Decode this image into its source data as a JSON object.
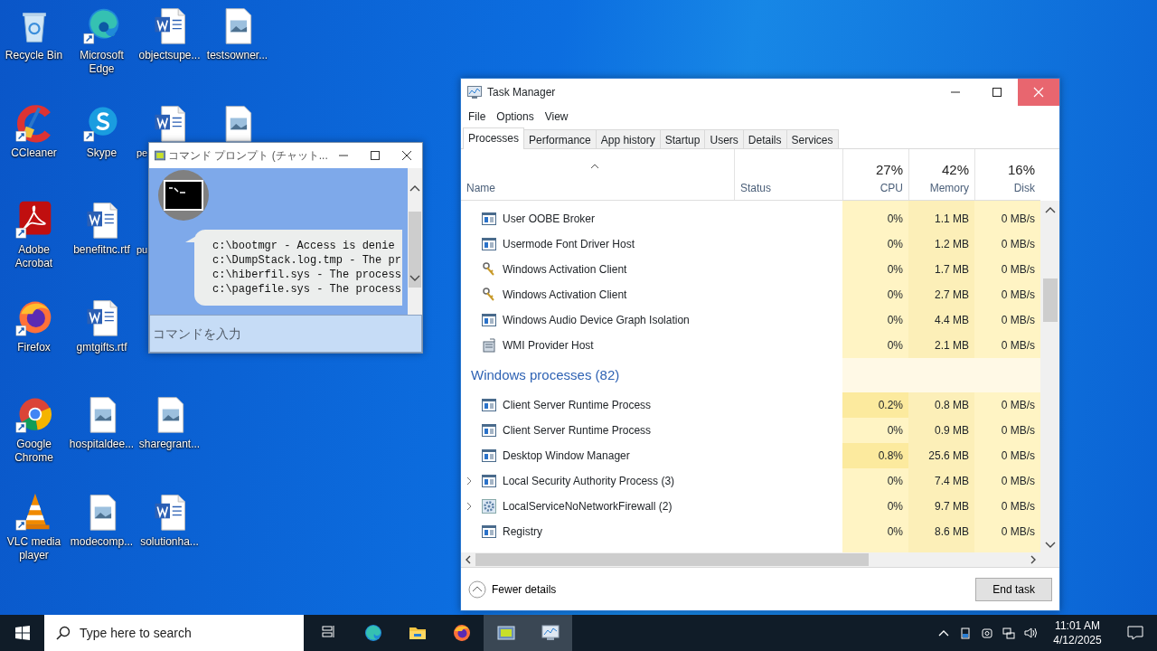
{
  "desktop_columns": [
    [
      {
        "label": "Recycle Bin",
        "kind": "recycle",
        "shortcut": false
      },
      {
        "label": "CCleaner",
        "kind": "ccleaner",
        "shortcut": true
      },
      {
        "label": "Adobe Acrobat",
        "kind": "acrobat",
        "shortcut": true
      },
      {
        "label": "Firefox",
        "kind": "firefox",
        "shortcut": true
      },
      {
        "label": "Google Chrome",
        "kind": "chrome",
        "shortcut": true
      },
      {
        "label": "VLC media player",
        "kind": "vlc",
        "shortcut": true
      }
    ],
    [
      {
        "label": "Microsoft Edge",
        "kind": "edge",
        "shortcut": true
      },
      {
        "label": "Skype",
        "kind": "skype",
        "shortcut": true
      },
      {
        "label": "benefitnc.rtf",
        "kind": "word",
        "shortcut": false
      },
      {
        "label": "gmtgifts.rtf",
        "kind": "word",
        "shortcut": false
      },
      {
        "label": "hospitaldee...",
        "kind": "image",
        "shortcut": false
      },
      {
        "label": "modecomp...",
        "kind": "image",
        "shortcut": false
      }
    ],
    [
      {
        "label": "objectsupe...",
        "kind": "word",
        "shortcut": false
      },
      {
        "label": "pe",
        "kind": "word-covered",
        "shortcut": false
      },
      {
        "label": "pu",
        "kind": "covered"
      },
      {
        "kind": "hidden"
      },
      {
        "label": "sharegrant...",
        "kind": "image",
        "shortcut": false
      },
      {
        "label": "solutionha...",
        "kind": "word",
        "shortcut": false
      }
    ],
    [
      {
        "label": "testsowner...",
        "kind": "image",
        "shortcut": false
      },
      {
        "kind": "image-covered",
        "shortcut": false
      }
    ]
  ],
  "chat_window": {
    "title": "コマンド プロンプト (チャット...",
    "lines": [
      "c:\\bootmgr - Access is denie",
      "c:\\DumpStack.log.tmp - The pr",
      "c:\\hiberfil.sys - The process",
      "c:\\pagefile.sys - The process"
    ],
    "input": {
      "placeholder": "コマンドを入力"
    }
  },
  "task_manager": {
    "title": "Task Manager",
    "menu": [
      "File",
      "Options",
      "View"
    ],
    "tabs": [
      {
        "label": "Processes",
        "selected": true
      },
      {
        "label": "Performance",
        "selected": false
      },
      {
        "label": "App history",
        "selected": false
      },
      {
        "label": "Startup",
        "selected": false
      },
      {
        "label": "Users",
        "selected": false
      },
      {
        "label": "Details",
        "selected": false
      },
      {
        "label": "Services",
        "selected": false
      }
    ],
    "columns": {
      "name": "Name",
      "status": "Status",
      "cpu": {
        "percent": "27%",
        "label": "CPU"
      },
      "memory": {
        "percent": "42%",
        "label": "Memory"
      },
      "disk": {
        "percent": "16%",
        "label": "Disk"
      }
    },
    "rows": [
      {
        "kind": "window",
        "name": "User OOBE Broker",
        "expandable": false,
        "cpu": "0%",
        "memory": "1.1 MB",
        "disk": "0 MB/s",
        "cpu_busy": false
      },
      {
        "kind": "window",
        "name": "Usermode Font Driver Host",
        "expandable": false,
        "cpu": "0%",
        "memory": "1.2 MB",
        "disk": "0 MB/s",
        "cpu_busy": false
      },
      {
        "kind": "keys",
        "name": "Windows Activation Client",
        "expandable": false,
        "cpu": "0%",
        "memory": "1.7 MB",
        "disk": "0 MB/s",
        "cpu_busy": false
      },
      {
        "kind": "keys",
        "name": "Windows Activation Client",
        "expandable": false,
        "cpu": "0%",
        "memory": "2.7 MB",
        "disk": "0 MB/s",
        "cpu_busy": false
      },
      {
        "kind": "window",
        "name": "Windows Audio Device Graph Isolation",
        "expandable": false,
        "cpu": "0%",
        "memory": "4.4 MB",
        "disk": "0 MB/s",
        "cpu_busy": false
      },
      {
        "kind": "server",
        "name": "WMI Provider Host",
        "expandable": false,
        "cpu": "0%",
        "memory": "2.1 MB",
        "disk": "0 MB/s",
        "cpu_busy": false
      },
      {
        "kind": "group",
        "name": "Windows processes (82)"
      },
      {
        "kind": "window",
        "name": "Client Server Runtime Process",
        "expandable": false,
        "cpu": "0.2%",
        "memory": "0.8 MB",
        "disk": "0 MB/s",
        "cpu_busy": true
      },
      {
        "kind": "window",
        "name": "Client Server Runtime Process",
        "expandable": false,
        "cpu": "0%",
        "memory": "0.9 MB",
        "disk": "0 MB/s",
        "cpu_busy": false
      },
      {
        "kind": "window",
        "name": "Desktop Window Manager",
        "expandable": false,
        "cpu": "0.8%",
        "memory": "25.6 MB",
        "disk": "0 MB/s",
        "cpu_busy": true
      },
      {
        "kind": "window",
        "name": "Local Security Authority Process (3)",
        "expandable": true,
        "cpu": "0%",
        "memory": "7.4 MB",
        "disk": "0 MB/s",
        "cpu_busy": false
      },
      {
        "kind": "gear",
        "name": "LocalServiceNoNetworkFirewall (2)",
        "expandable": true,
        "cpu": "0%",
        "memory": "9.7 MB",
        "disk": "0 MB/s",
        "cpu_busy": false
      },
      {
        "kind": "window",
        "name": "Registry",
        "expandable": false,
        "cpu": "0%",
        "memory": "8.6 MB",
        "disk": "0 MB/s",
        "cpu_busy": false
      }
    ],
    "fewer_details": "Fewer details",
    "end_task": "End task"
  },
  "taskbar": {
    "search": {
      "placeholder": "Type here to search"
    },
    "apps": [
      {
        "kind": "taskview",
        "active": false
      },
      {
        "kind": "edge",
        "active": false
      },
      {
        "kind": "folder",
        "active": false
      },
      {
        "kind": "firefox",
        "active": false
      },
      {
        "kind": "chat",
        "active": true
      },
      {
        "kind": "taskmgr",
        "active": true
      }
    ],
    "time": "11:01 AM",
    "date": "4/12/2025"
  }
}
